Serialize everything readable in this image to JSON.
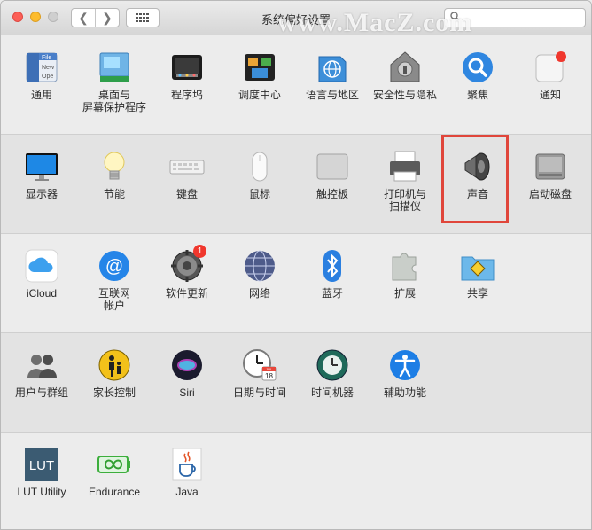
{
  "window": {
    "title": "系统偏好设置"
  },
  "search": {
    "placeholder": ""
  },
  "watermark": {
    "text": "www.MacZ.com"
  },
  "rows": [
    {
      "items": [
        {
          "name": "general",
          "label": "通用",
          "icon": "general-icon"
        },
        {
          "name": "desktop",
          "label": "桌面与\n屏幕保护程序",
          "icon": "desktop-icon"
        },
        {
          "name": "dock",
          "label": "程序坞",
          "icon": "dock-icon"
        },
        {
          "name": "mission-control",
          "label": "调度中心",
          "icon": "mission-control-icon"
        },
        {
          "name": "language",
          "label": "语言与地区",
          "icon": "globe-icon"
        },
        {
          "name": "security",
          "label": "安全性与隐私",
          "icon": "house-lock-icon"
        },
        {
          "name": "spotlight",
          "label": "聚焦",
          "icon": "magnifier-icon"
        },
        {
          "name": "notifications",
          "label": "通知",
          "icon": "notification-icon"
        }
      ]
    },
    {
      "items": [
        {
          "name": "displays",
          "label": "显示器",
          "icon": "display-icon"
        },
        {
          "name": "energy",
          "label": "节能",
          "icon": "bulb-icon"
        },
        {
          "name": "keyboard",
          "label": "键盘",
          "icon": "keyboard-icon"
        },
        {
          "name": "mouse",
          "label": "鼠标",
          "icon": "mouse-icon"
        },
        {
          "name": "trackpad",
          "label": "触控板",
          "icon": "trackpad-icon"
        },
        {
          "name": "printers",
          "label": "打印机与\n扫描仪",
          "icon": "printer-icon"
        },
        {
          "name": "sound",
          "label": "声音",
          "icon": "speaker-icon"
        },
        {
          "name": "startup-disk",
          "label": "启动磁盘",
          "icon": "disk-icon"
        }
      ]
    },
    {
      "items": [
        {
          "name": "icloud",
          "label": "iCloud",
          "icon": "cloud-icon"
        },
        {
          "name": "internet-accounts",
          "label": "互联网\n帐户",
          "icon": "at-sign-icon"
        },
        {
          "name": "software-update",
          "label": "软件更新",
          "icon": "gear-icon",
          "badge": "1"
        },
        {
          "name": "network",
          "label": "网络",
          "icon": "network-globe-icon"
        },
        {
          "name": "bluetooth",
          "label": "蓝牙",
          "icon": "bluetooth-icon"
        },
        {
          "name": "extensions",
          "label": "扩展",
          "icon": "puzzle-icon"
        },
        {
          "name": "sharing",
          "label": "共享",
          "icon": "sharing-folder-icon"
        }
      ]
    },
    {
      "items": [
        {
          "name": "users",
          "label": "用户与群组",
          "icon": "users-icon"
        },
        {
          "name": "parental",
          "label": "家长控制",
          "icon": "parental-icon"
        },
        {
          "name": "siri",
          "label": "Siri",
          "icon": "siri-icon"
        },
        {
          "name": "datetime",
          "label": "日期与时间",
          "icon": "clock-calendar-icon",
          "calendar_month": "JUL",
          "calendar_day": "18"
        },
        {
          "name": "timemachine",
          "label": "时间机器",
          "icon": "time-machine-icon"
        },
        {
          "name": "accessibility",
          "label": "辅助功能",
          "icon": "accessibility-icon"
        }
      ]
    },
    {
      "items": [
        {
          "name": "lut-utility",
          "label": "LUT Utility",
          "icon": "lut-icon",
          "icon_text": "LUT"
        },
        {
          "name": "endurance",
          "label": "Endurance",
          "icon": "battery-infinity-icon"
        },
        {
          "name": "java",
          "label": "Java",
          "icon": "java-cup-icon"
        }
      ]
    }
  ],
  "general_icon_text": [
    "File",
    "New",
    "Ope"
  ],
  "highlight_color": "#e0463b"
}
